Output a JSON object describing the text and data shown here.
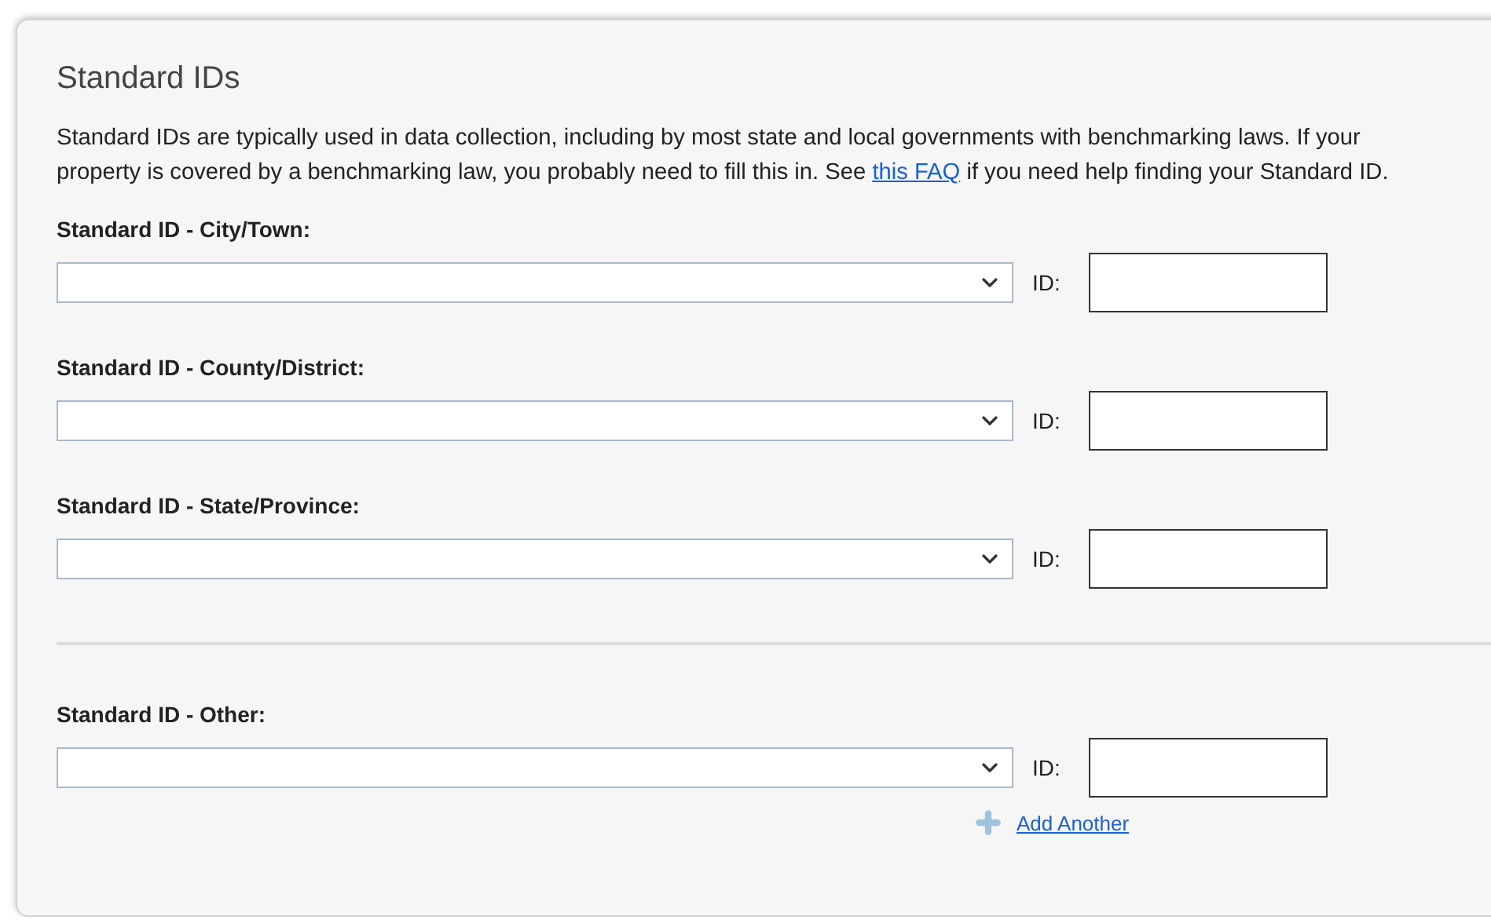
{
  "panel": {
    "title": "Standard IDs",
    "description": {
      "before": "Standard IDs are typically used in data collection, including by most state and local governments with benchmarking laws. If your property is covered by a benchmarking law, you probably need to fill this in. See ",
      "link": "this FAQ",
      "after": " if you need help finding your Standard ID."
    },
    "fields": [
      {
        "label": "Standard ID - City/Town:",
        "id_label": "ID:"
      },
      {
        "label": "Standard ID - County/District:",
        "id_label": "ID:"
      },
      {
        "label": "Standard ID - State/Province:",
        "id_label": "ID:"
      }
    ],
    "other": {
      "label": "Standard ID - Other:",
      "id_label": "ID:",
      "add_link": "Add Another"
    }
  }
}
